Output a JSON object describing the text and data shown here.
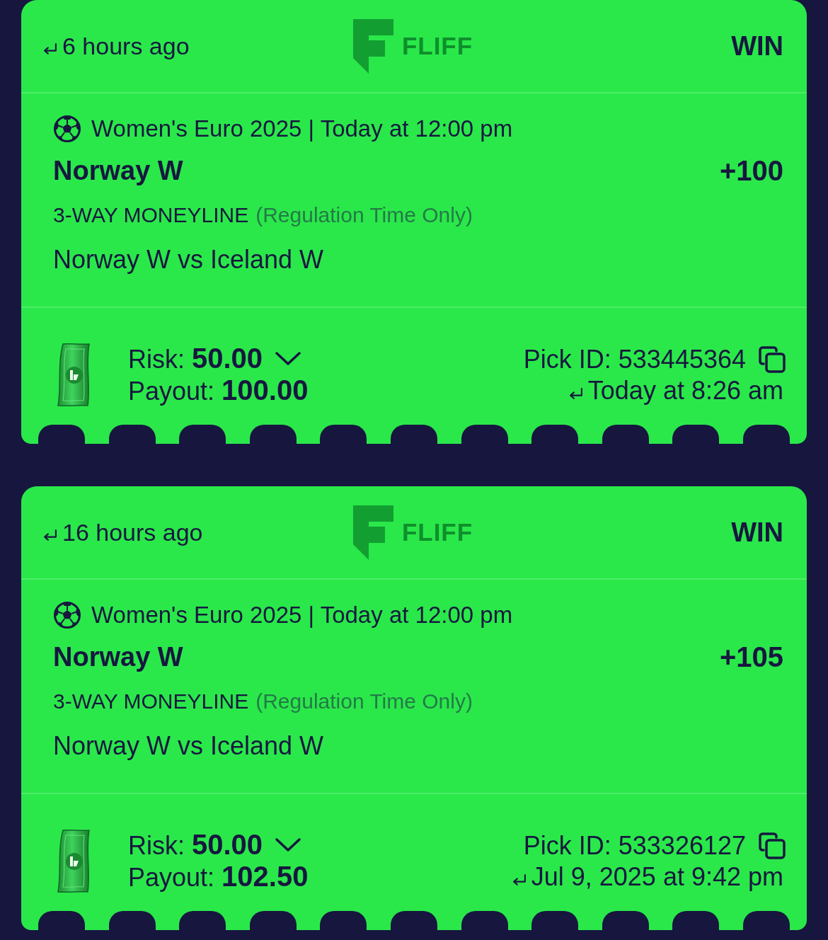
{
  "picks": [
    {
      "placed_ago": "6 hours ago",
      "logo_text": "FLIFF",
      "result": "WIN",
      "league_time": "Women's Euro 2025 | Today at 12:00 pm",
      "selection": "Norway W",
      "odds": "+100",
      "market": "3-WAY MONEYLINE",
      "market_note": "(Regulation Time Only)",
      "matchup": "Norway W vs Iceland W",
      "risk": "Risk: **50.00**",
      "payout": "Payout: **100.00**",
      "pick_id": "Pick ID: 533445364",
      "placed_at": "Today at 8:26 am"
    },
    {
      "placed_ago": "16 hours ago",
      "logo_text": "FLIFF",
      "result": "WIN",
      "league_time": "Women's Euro 2025 | Today at 12:00 pm",
      "selection": "Norway W",
      "odds": "+105",
      "market": "3-WAY MONEYLINE",
      "market_note": "(Regulation Time Only)",
      "matchup": "Norway W vs Iceland W",
      "risk": "Risk: **50.00**",
      "payout": "Payout: **102.50**",
      "pick_id": "Pick ID: 533326127",
      "placed_at": "Jul 9, 2025 at 9:42 pm"
    }
  ]
}
